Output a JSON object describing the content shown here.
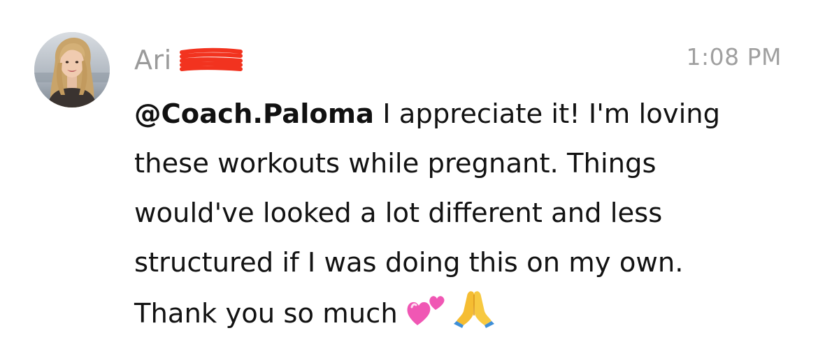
{
  "message": {
    "author_name": "Ari",
    "timestamp": "1:08 PM",
    "mention": "@Coach.Paloma",
    "lines": [
      " I appreciate it! I'm loving",
      "these workouts while pregnant. Things",
      "would've looked a lot different and less",
      "structured if I was doing this on my own.",
      "Thank you so much"
    ],
    "emojis": [
      "two-hearts",
      "folded-hands"
    ]
  },
  "colors": {
    "author": "#9a9a9a",
    "timestamp": "#a0a0a0",
    "text": "#121212",
    "redaction": "#f2331f"
  }
}
